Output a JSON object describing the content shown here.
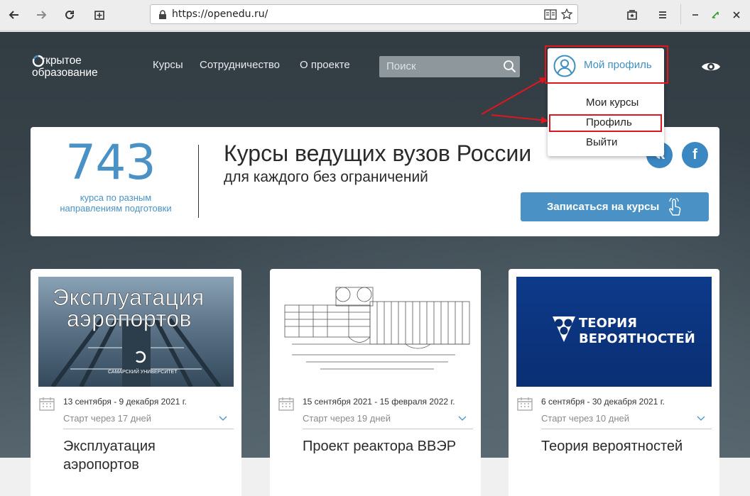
{
  "browser": {
    "url": "https://openedu.ru/",
    "nav_icons": [
      "back-arrow-icon",
      "forward-arrow-icon",
      "reload-icon",
      "new-tab-icon"
    ],
    "right_icons": [
      "reader-view-icon",
      "bookmark-star-icon",
      "library-icon",
      "menu-icon"
    ],
    "window_icons": [
      "minimize-icon",
      "restore-icon",
      "close-icon"
    ]
  },
  "site": {
    "logo": {
      "line1": "ткрытое",
      "line2": "образование"
    },
    "menu": [
      "Курсы",
      "Сотрудничество",
      "О проекте"
    ],
    "search_placeholder": "Поиск",
    "profile": {
      "label": "Мой профиль",
      "items": [
        "Мои курсы",
        "Профиль",
        "Выйти"
      ]
    }
  },
  "banner": {
    "count": "743",
    "count_caption_1": "курса по разным",
    "count_caption_2": "направлениям подготовки",
    "title": "Курсы ведущих вузов России",
    "subtitle": "для каждого без ограничений",
    "social": [
      "vk",
      "f"
    ],
    "cta": "Записаться на курсы"
  },
  "courses": [
    {
      "image_text": [
        "Эксплуатация",
        "аэропортов"
      ],
      "image_caption": "САМАРСКИЙ УНИВЕРСИТЕТ",
      "dates": "13 сентября - 9 декабря 2021 г.",
      "start": "Старт через 17 дней",
      "title": "Эксплуатация аэропортов"
    },
    {
      "image_text": [],
      "dates": "15 сентября 2021 - 15 февраля 2022 г.",
      "start": "Старт через 19 дней",
      "title": "Проект реактора ВВЭР"
    },
    {
      "image_text": [
        "ТЕОРИЯ",
        "ВЕРОЯТНОСТЕЙ"
      ],
      "dates": "6 сентября - 30 декабря 2021 г.",
      "start": "Старт через 10 дней",
      "title": "Теория вероятностей"
    }
  ],
  "colors": {
    "accent": "#4a92c5",
    "annotation": "#e0161f",
    "hero_bg": "#323c43"
  }
}
